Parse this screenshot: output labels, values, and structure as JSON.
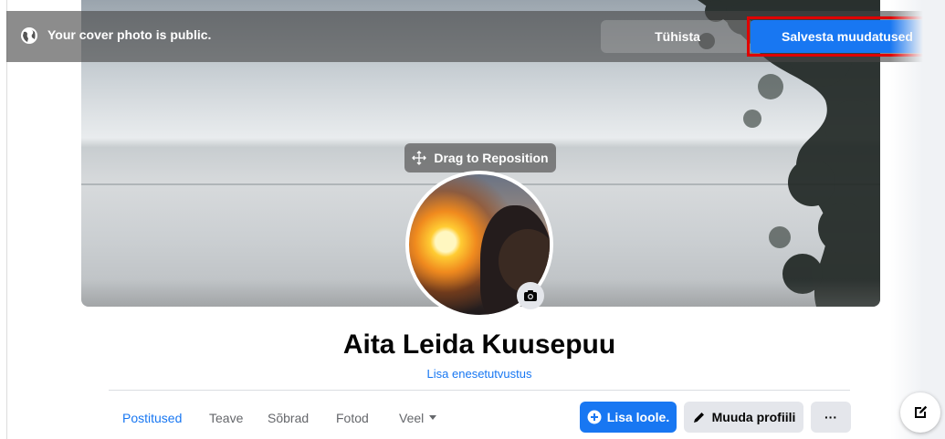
{
  "notice": {
    "text": "Your cover photo is public.",
    "cancel_label": "Tühista",
    "save_label": "Salvesta muudatused"
  },
  "cover": {
    "drag_label": "Drag to Reposition"
  },
  "profile": {
    "name": "Aita Leida Kuusepuu",
    "bio_link": "Lisa enesetutvustus"
  },
  "tabs": [
    {
      "label": "Postitused",
      "active": true
    },
    {
      "label": "Teave",
      "active": false
    },
    {
      "label": "Sõbrad",
      "active": false
    },
    {
      "label": "Fotod",
      "active": false
    },
    {
      "label": "Veel",
      "active": false
    }
  ],
  "actions": {
    "add_story": "Lisa loole.",
    "edit_profile": "Muuda profiili",
    "more": "···"
  },
  "colors": {
    "accent": "#1877f2",
    "highlight": "#e00000"
  },
  "icons": [
    "globe-icon",
    "move-icon",
    "camera-icon",
    "plus-circle-icon",
    "pencil-icon",
    "caret-down-icon",
    "compose-icon"
  ]
}
